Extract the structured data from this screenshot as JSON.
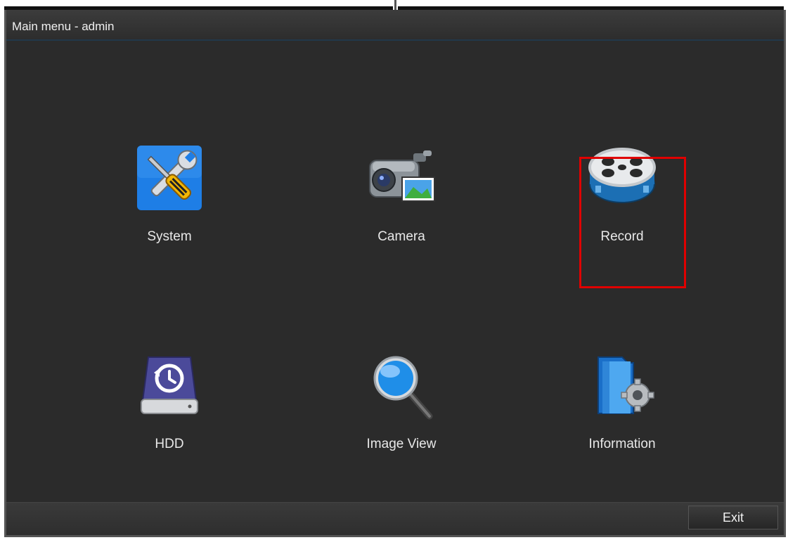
{
  "window": {
    "title": "Main menu - admin"
  },
  "menu": {
    "items": [
      {
        "label": "System",
        "icon": "system-tools-icon"
      },
      {
        "label": "Camera",
        "icon": "camera-icon"
      },
      {
        "label": "Record",
        "icon": "record-film-reel-icon",
        "highlighted": true
      },
      {
        "label": "HDD",
        "icon": "hdd-icon"
      },
      {
        "label": "Image View",
        "icon": "image-view-magnifier-icon"
      },
      {
        "label": "Information",
        "icon": "information-folder-gear-icon"
      }
    ]
  },
  "footer": {
    "exit_label": "Exit"
  },
  "colors": {
    "highlight": "#e00000",
    "background": "#2b2b2b"
  }
}
